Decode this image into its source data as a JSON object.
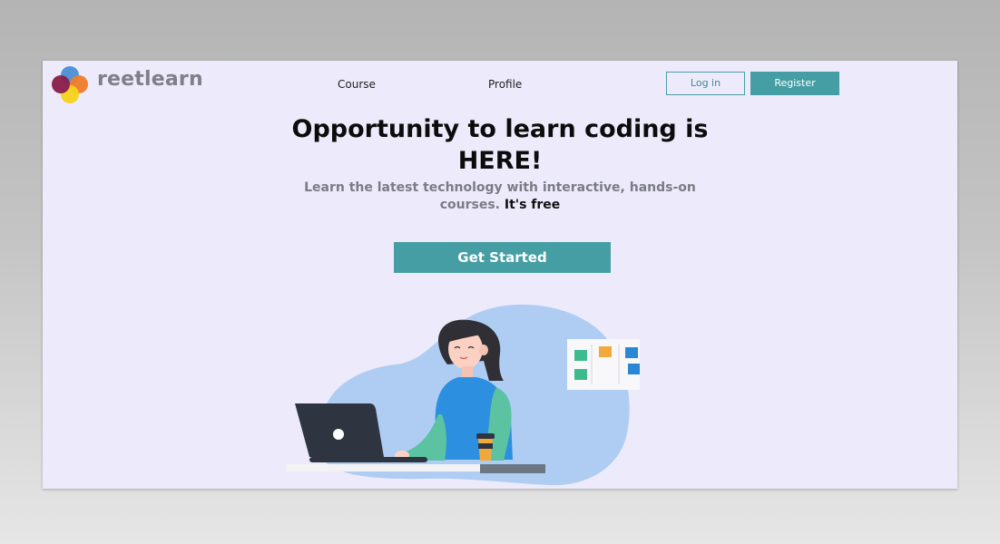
{
  "brand": {
    "name": "reetlearn",
    "logo_colors": [
      "#4a8fd4",
      "#f07c2c",
      "#8a1c4a",
      "#f5d31a"
    ]
  },
  "nav": {
    "links": [
      "Course",
      "Profile"
    ],
    "login_label": "Log in",
    "register_label": "Register"
  },
  "hero": {
    "title": "Opportunity to learn coding is HERE!",
    "subtitle": "Learn the latest technology with interactive, hands-on courses.",
    "subtitle_emphasis": "It's free",
    "cta_label": "Get Started"
  },
  "colors": {
    "accent": "#459ea3",
    "page_background": "#edebfb",
    "blob": "#afcdf2"
  }
}
